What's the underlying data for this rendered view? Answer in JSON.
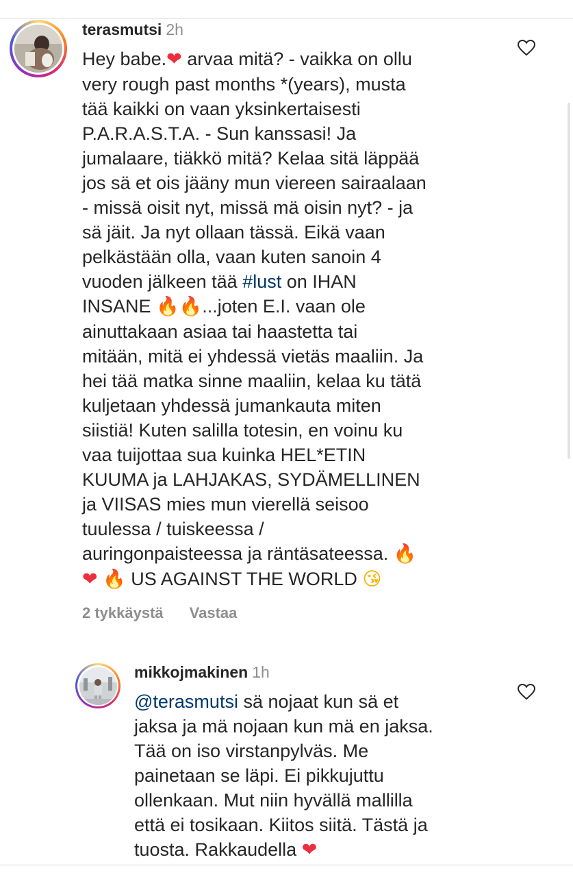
{
  "comment1": {
    "username": "terasmutsi",
    "time": "2h",
    "lines": [
      [
        "Hey babe.",
        {
          "emoji": "❤",
          "kind": "heart"
        },
        " arvaa mitä? - vaikka on ollu"
      ],
      [
        "very rough past months *(years), musta"
      ],
      [
        "tää kaikki on vaan yksinkertaisesti"
      ],
      [
        "P.A.R.A.S.T.A. - Sun kanssasi! Ja"
      ],
      [
        "jumalaare, tiäkkö mitä? Kelaa sitä läppää"
      ],
      [
        "jos sä et ois jääny mun viereen sairaalaan"
      ],
      [
        "- missä oisit nyt, missä mä oisin nyt? - ja"
      ],
      [
        "sä jäit. Ja nyt ollaan tässä. Eikä vaan"
      ],
      [
        "pelkästään olla, vaan kuten sanoin 4"
      ],
      [
        "vuoden jälkeen tää ",
        {
          "tag": "#lust"
        },
        " on IHAN"
      ],
      [
        "INSANE ",
        {
          "emoji": "🔥",
          "kind": "fire"
        },
        {
          "emoji": "🔥",
          "kind": "fire"
        },
        "...joten E.I. vaan ole"
      ],
      [
        "ainuttakaan asiaa tai haastetta tai"
      ],
      [
        "mitään, mitä ei yhdessä vietäs maaliin. Ja"
      ],
      [
        "hei tää matka sinne maaliin, kelaa ku tätä"
      ],
      [
        "kuljetaan yhdessä jumankauta miten"
      ],
      [
        "siistiä! Kuten salilla totesin, en voinu ku"
      ],
      [
        "vaa tuijottaa sua kuinka HEL*ETIN"
      ],
      [
        "KUUMA ja LAHJAKAS, SYDÄMELLINEN"
      ],
      [
        "ja VIISAS mies mun vierellä seisoo"
      ],
      [
        "tuulessa / tuiskeessa /"
      ],
      [
        "auringonpaisteessa ja räntäsateessa. ",
        {
          "emoji": "🔥",
          "kind": "fire"
        }
      ],
      [
        {
          "emoji": "❤",
          "kind": "heart"
        },
        " ",
        {
          "emoji": "🔥",
          "kind": "fire"
        },
        " US AGAINST THE WORLD ",
        {
          "emoji": "😘",
          "kind": "kiss"
        }
      ]
    ],
    "likes": "2 tykkäystä",
    "reply": "Vastaa"
  },
  "comment2": {
    "username": "mikkojmakinen",
    "time": "1h",
    "lines": [
      [
        {
          "mention": "@terasmutsi"
        },
        " sä nojaat kun sä et"
      ],
      [
        "jaksa ja mä nojaan kun mä en jaksa."
      ],
      [
        "Tää on iso virstanpylväs. Me"
      ],
      [
        "painetaan se läpi. Ei pikkujuttu"
      ],
      [
        "ollenkaan. Mut niin hyvällä mallilla"
      ],
      [
        "että ei tosikaan. Kiitos siitä. Tästä ja"
      ],
      [
        "tuosta. Rakkaudella ",
        {
          "emoji": "❤",
          "kind": "heart"
        }
      ]
    ]
  },
  "icons": {
    "like": "heart-outline-icon",
    "avatar1": "profile-photo",
    "avatar2": "profile-photo"
  },
  "colors": {
    "text": "#262626",
    "muted": "#8e8e8e",
    "link": "#00376b",
    "heart": "#ed2e3f"
  }
}
